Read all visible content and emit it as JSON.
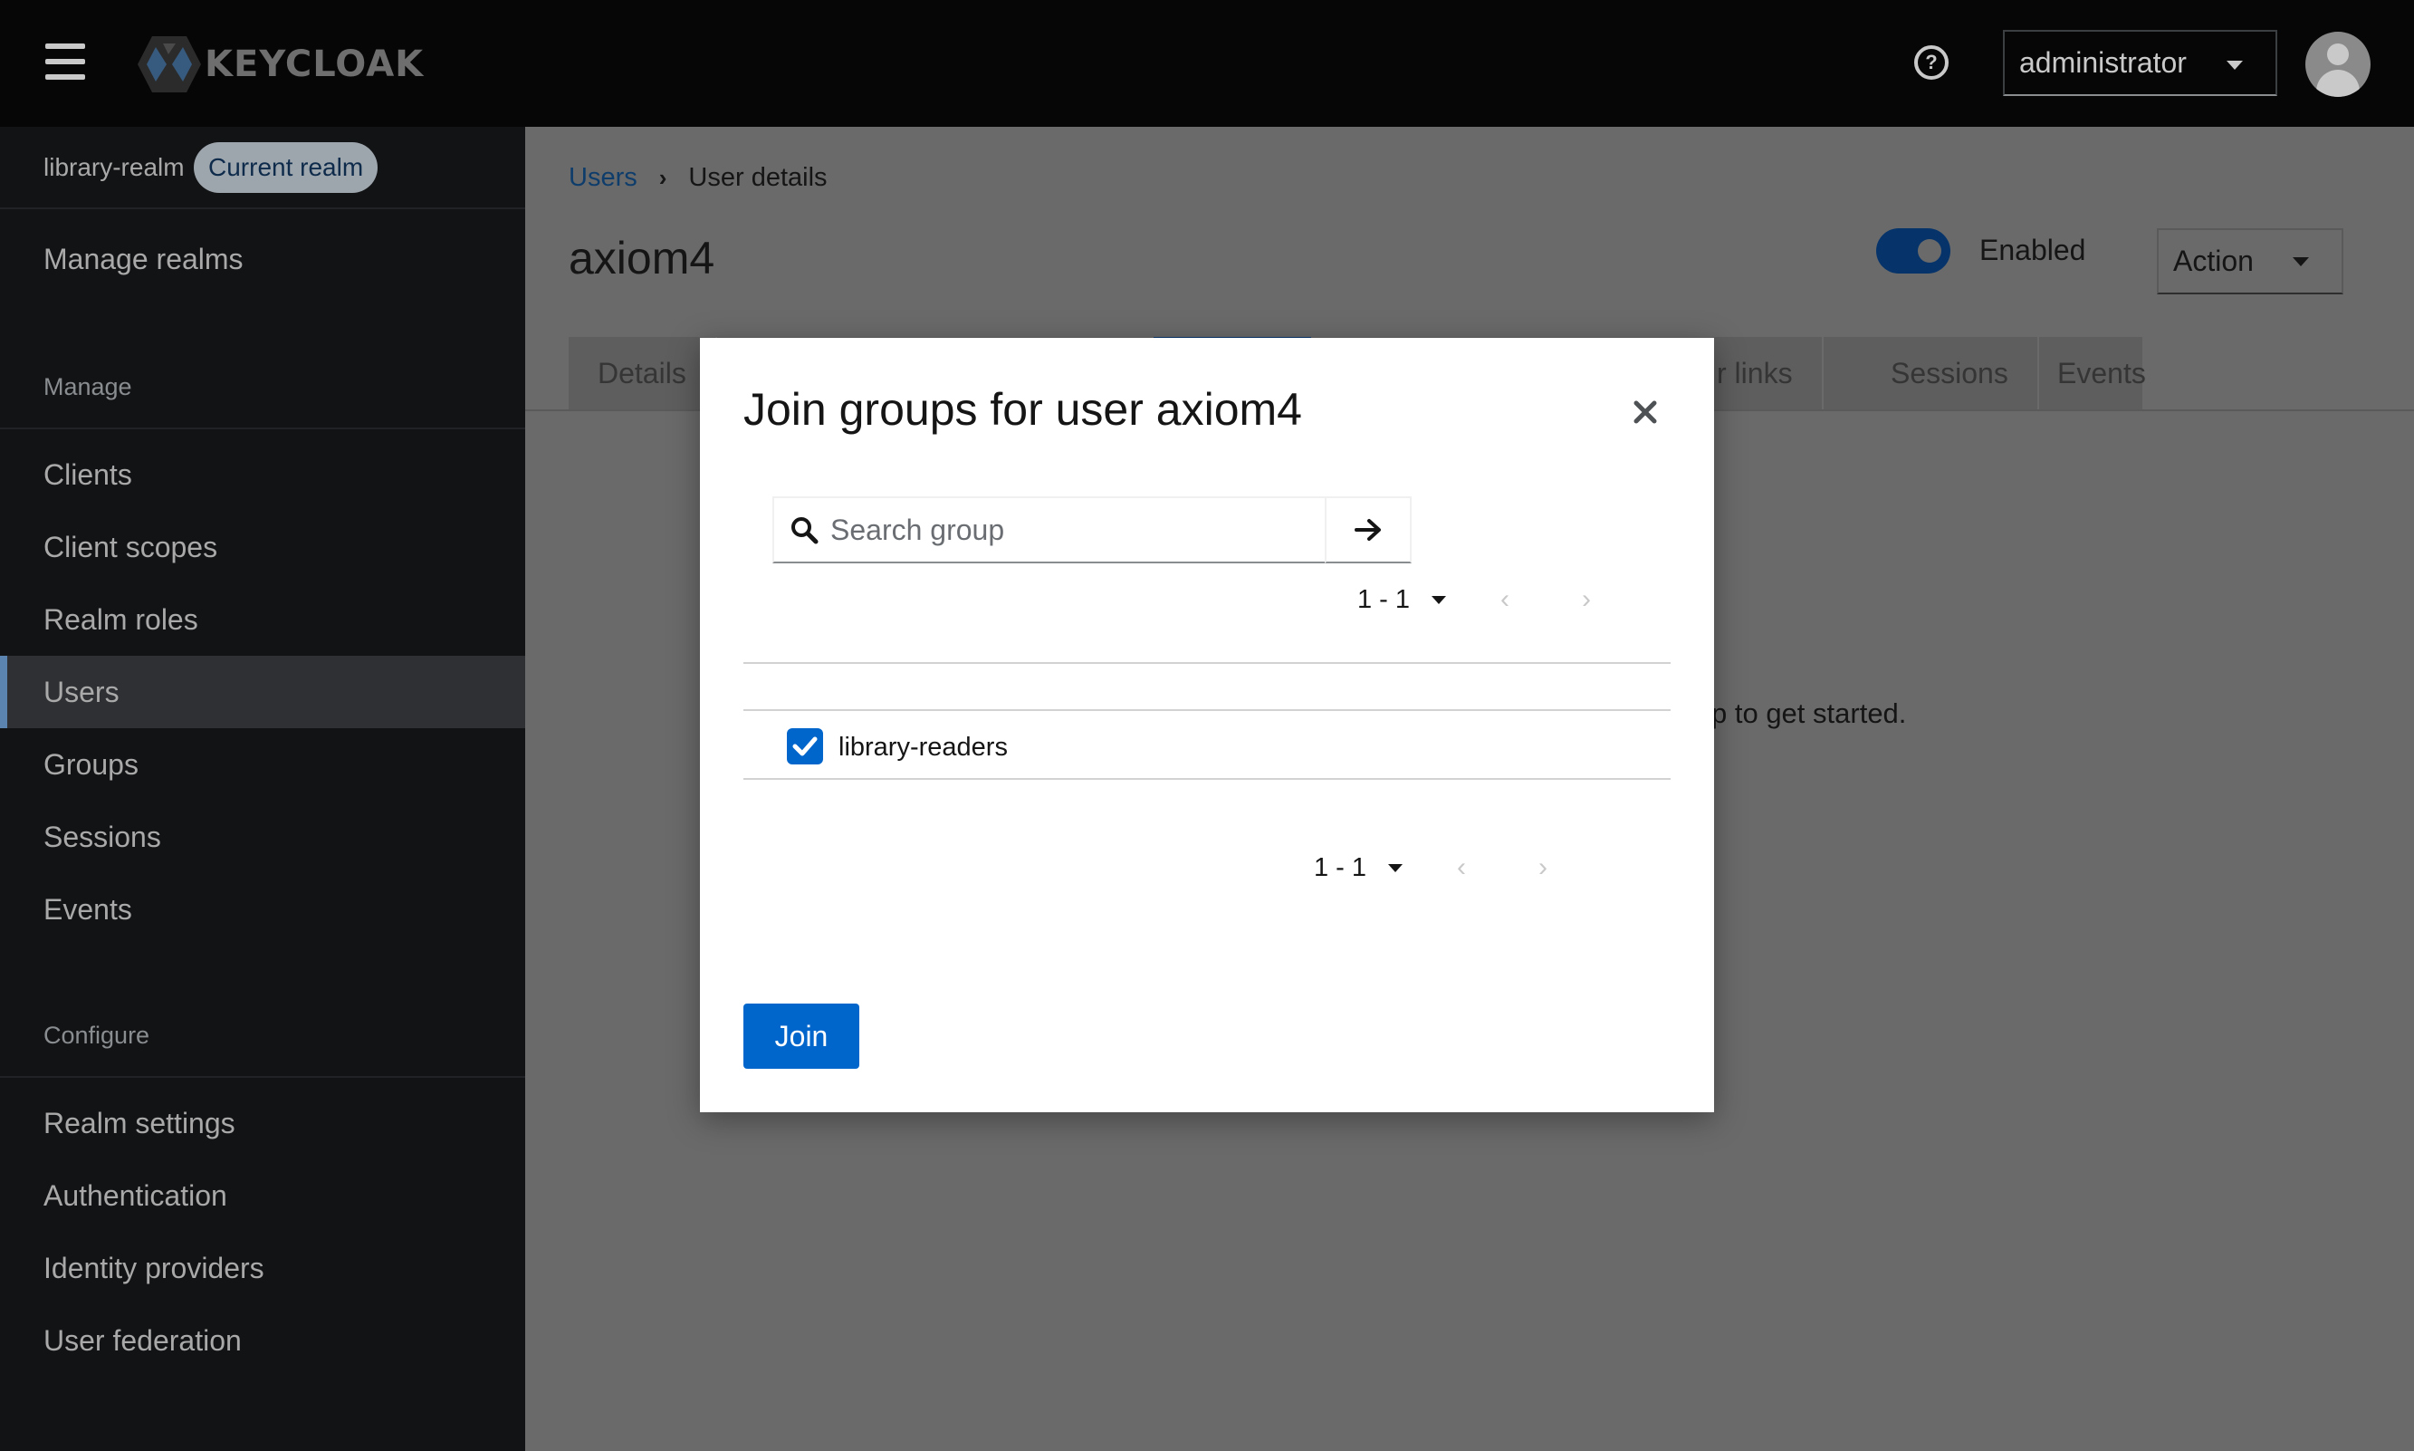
{
  "masthead": {
    "logo_text": "KEYCLOAK",
    "user_label": "administrator"
  },
  "sidebar": {
    "realm_name": "library-realm",
    "realm_badge": "Current realm",
    "manage_realms": "Manage realms",
    "manage_section": "Manage",
    "manage_items": [
      "Clients",
      "Client scopes",
      "Realm roles",
      "Users",
      "Groups",
      "Sessions",
      "Events"
    ],
    "active_item": "Users",
    "configure_section": "Configure",
    "configure_items": [
      "Realm settings",
      "Authentication",
      "Identity providers",
      "User federation"
    ]
  },
  "main": {
    "breadcrumb_root": "Users",
    "breadcrumb_current": "User details",
    "title": "axiom4",
    "enabled_label": "Enabled",
    "enabled": true,
    "action_label": "Action",
    "tabs": [
      "Details",
      "r links",
      "Sessions",
      "Events"
    ],
    "empty_text": "p to get started."
  },
  "modal": {
    "title": "Join groups for user axiom4",
    "search_placeholder": "Search group",
    "pagination_top": "1 - 1",
    "pagination_bottom": "1 - 1",
    "groups": [
      {
        "name": "library-readers",
        "checked": true
      }
    ],
    "join_label": "Join"
  },
  "colors": {
    "accent": "#0066cc",
    "masthead_bg": "#060606",
    "sidebar_bg": "#121315",
    "backdrop": "#6a6a6a"
  }
}
